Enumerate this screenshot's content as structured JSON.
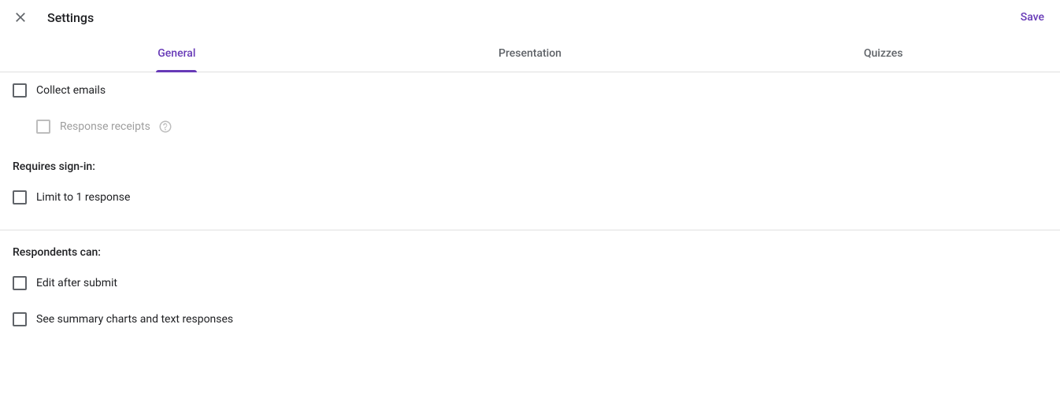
{
  "header": {
    "title": "Settings",
    "save_label": "Save"
  },
  "tabs": {
    "general": "General",
    "presentation": "Presentation",
    "quizzes": "Quizzes"
  },
  "options": {
    "collect_emails": "Collect emails",
    "response_receipts": "Response receipts",
    "limit_one": "Limit to 1 response",
    "edit_after": "Edit after submit",
    "see_summary": "See summary charts and text responses"
  },
  "sections": {
    "requires_signin": "Requires sign-in:",
    "respondents_can": "Respondents can:"
  }
}
